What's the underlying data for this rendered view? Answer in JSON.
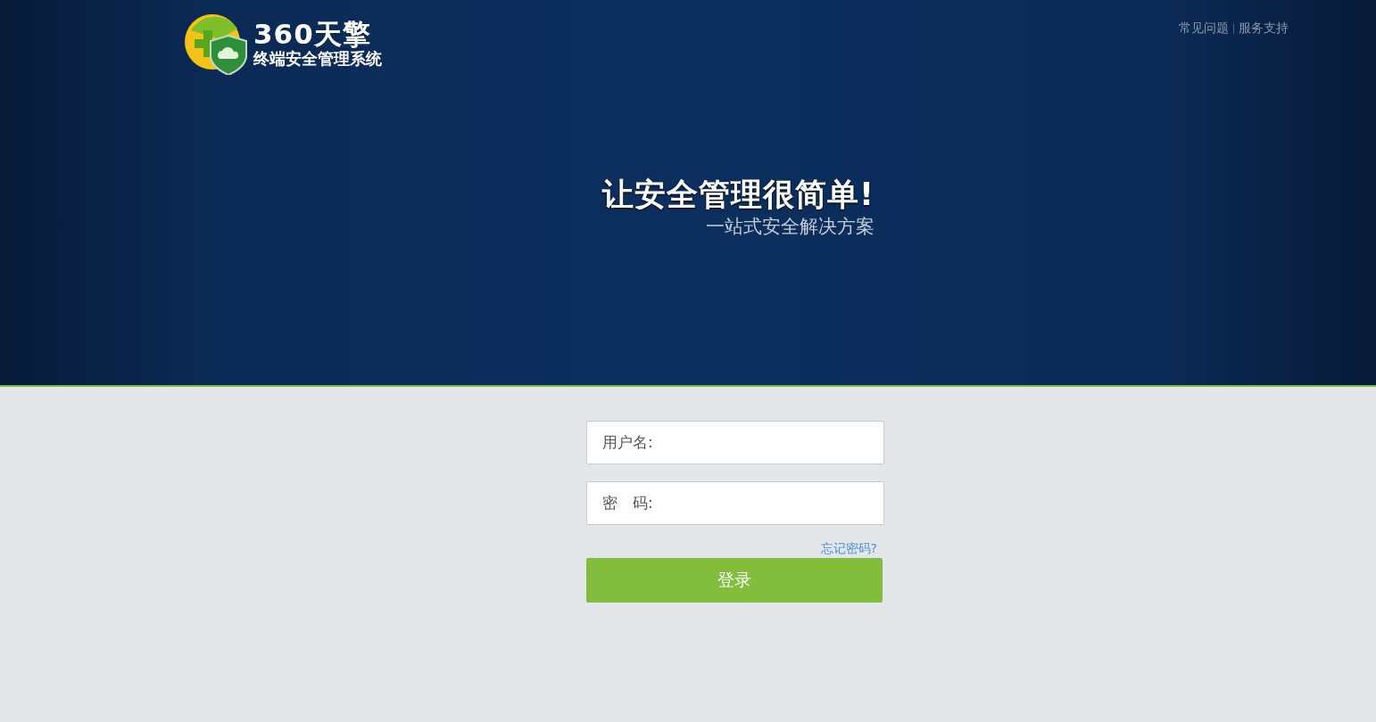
{
  "header": {
    "logo": {
      "title": "360天擎",
      "subtitle": "终端安全管理系统"
    },
    "links": [
      "常见问题",
      "服务支持"
    ]
  },
  "banner": {
    "headline": "让安全管理很简单!",
    "tagline": "一站式安全解决方案"
  },
  "login": {
    "fields": [
      {
        "label": "用户名:"
      },
      {
        "label": "密　码:"
      }
    ],
    "forgot_link": "忘记密码?",
    "submit": "登录"
  }
}
